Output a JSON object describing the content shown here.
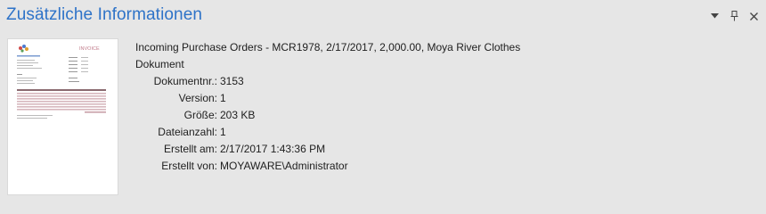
{
  "panel": {
    "title": "Zusätzliche Informationen",
    "controls": [
      {
        "icon": "dropdown-arrow-icon"
      },
      {
        "icon": "pin-icon"
      },
      {
        "icon": "close-icon"
      }
    ]
  },
  "document": {
    "summary": "Incoming Purchase Orders - MCR1978, 2/17/2017, 2,000.00, Moya River Clothes",
    "type": "Dokument",
    "thumbnail_heading": "INVOICE"
  },
  "properties": [
    {
      "label": "Dokumentnr.:",
      "value": "3153"
    },
    {
      "label": "Version:",
      "value": "1"
    },
    {
      "label": "Größe:",
      "value": "203 KB"
    },
    {
      "label": "Dateianzahl:",
      "value": "1"
    },
    {
      "label": "Erstellt am:",
      "value": "2/17/2017 1:43:36 PM"
    },
    {
      "label": "Erstellt von:",
      "value": "MOYAWARE\\Administrator"
    }
  ],
  "colors": {
    "title": "#2e73c8",
    "background": "#e6e6e6",
    "thumbnail_accent": "#c9a0a8"
  }
}
